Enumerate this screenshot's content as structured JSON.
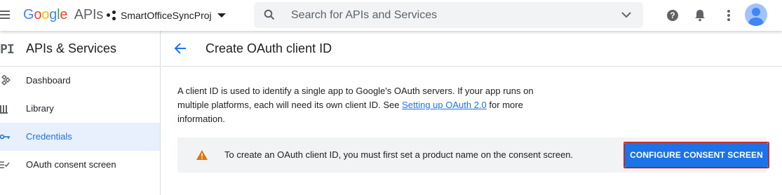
{
  "topbar": {
    "logo_google": "Google",
    "logo_apis": "APIs",
    "project_name": "SmartOfficeSyncProj",
    "search_placeholder": "Search for APIs and Services"
  },
  "sidebar": {
    "badge": "PI",
    "title": "APIs & Services",
    "items": [
      {
        "label": "Dashboard",
        "icon": "dashboard-icon"
      },
      {
        "label": "Library",
        "icon": "library-icon"
      },
      {
        "label": "Credentials",
        "icon": "key-icon",
        "active": true
      },
      {
        "label": "OAuth consent screen",
        "icon": "consent-icon"
      }
    ]
  },
  "main": {
    "title": "Create OAuth client ID",
    "description_pre": "A client ID is used to identify a single app to Google's OAuth servers. If your app runs on multiple platforms, each will need its own client ID. See ",
    "description_link": "Setting up OAuth 2.0",
    "description_post": " for more information.",
    "notice_text": "To create an OAuth client ID, you must first set a product name on the consent screen.",
    "cta_label": "CONFIGURE CONSENT SCREEN"
  },
  "colors": {
    "accent": "#1a73e8",
    "warning": "#e37400",
    "highlight_border": "#d32f2f"
  }
}
